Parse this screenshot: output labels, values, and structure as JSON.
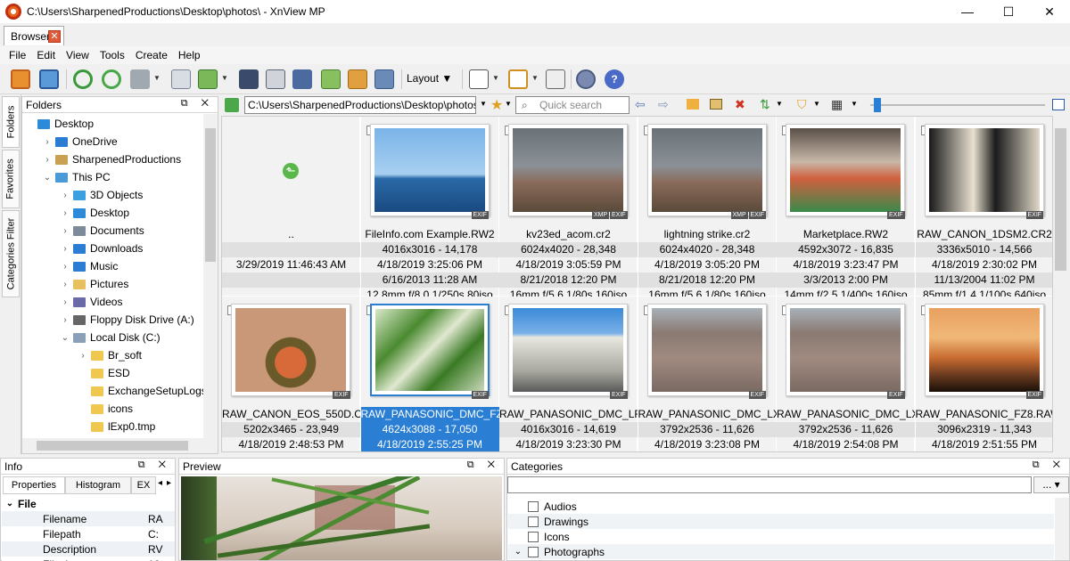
{
  "window": {
    "title": "C:\\Users\\SharpenedProductions\\Desktop\\photos\\ - XnView MP",
    "minimize": "—",
    "maximize": "☐",
    "close": "✕"
  },
  "tabs": [
    {
      "label": "Browser",
      "close": "✕"
    }
  ],
  "menu": [
    "File",
    "Edit",
    "View",
    "Tools",
    "Create",
    "Help"
  ],
  "toolbar": {
    "layout_label": "Layout"
  },
  "side_tabs": [
    "Folders",
    "Favorites",
    "Categories Filter"
  ],
  "folders": {
    "title": "Folders",
    "controls": "⧉ ✕",
    "items": [
      {
        "label": "Desktop",
        "level": 0,
        "expander": "",
        "icon": "desktop-icon",
        "color": "#2d8ad8"
      },
      {
        "label": "OneDrive",
        "level": 1,
        "expander": "›",
        "icon": "cloud-icon",
        "color": "#2b7cd3"
      },
      {
        "label": "SharpenedProductions",
        "level": 1,
        "expander": "›",
        "icon": "user-folder-icon",
        "color": "#caa052"
      },
      {
        "label": "This PC",
        "level": 1,
        "expander": "⌄",
        "icon": "computer-icon",
        "color": "#4a9ad8"
      },
      {
        "label": "3D Objects",
        "level": 2,
        "expander": "›",
        "icon": "3d-objects-icon",
        "color": "#3aa0e0"
      },
      {
        "label": "Desktop",
        "level": 2,
        "expander": "›",
        "icon": "desktop-icon",
        "color": "#2d8ad8"
      },
      {
        "label": "Documents",
        "level": 2,
        "expander": "›",
        "icon": "documents-icon",
        "color": "#7c8a9a"
      },
      {
        "label": "Downloads",
        "level": 2,
        "expander": "›",
        "icon": "downloads-icon",
        "color": "#2b7cd3"
      },
      {
        "label": "Music",
        "level": 2,
        "expander": "›",
        "icon": "music-icon",
        "color": "#2b7cd3"
      },
      {
        "label": "Pictures",
        "level": 2,
        "expander": "›",
        "icon": "pictures-icon",
        "color": "#e8c060"
      },
      {
        "label": "Videos",
        "level": 2,
        "expander": "›",
        "icon": "videos-icon",
        "color": "#6a6aa8"
      },
      {
        "label": "Floppy Disk Drive (A:)",
        "level": 2,
        "expander": "›",
        "icon": "floppy-icon",
        "color": "#666666"
      },
      {
        "label": "Local Disk (C:)",
        "level": 2,
        "expander": "⌄",
        "icon": "disk-icon",
        "color": "#8aa0b8"
      },
      {
        "label": "Br_soft",
        "level": 3,
        "expander": "›",
        "icon": "folder-icon",
        "color": "#f0c850"
      },
      {
        "label": "ESD",
        "level": 3,
        "expander": "",
        "icon": "folder-icon",
        "color": "#f0c850"
      },
      {
        "label": "ExchangeSetupLogs",
        "level": 3,
        "expander": "",
        "icon": "folder-icon",
        "color": "#f0c850"
      },
      {
        "label": "icons",
        "level": 3,
        "expander": "",
        "icon": "folder-icon",
        "color": "#f0c850"
      },
      {
        "label": "lExp0.tmp",
        "level": 3,
        "expander": "",
        "icon": "folder-icon",
        "color": "#f0c850"
      }
    ]
  },
  "address": {
    "path": "C:\\Users\\SharpenedProductions\\Desktop\\photos\\",
    "search_placeholder": "Quick search"
  },
  "grid": {
    "items": [
      {
        "name": "..",
        "lines": [
          "",
          "3/29/2019 11:46:43 AM",
          "",
          ""
        ],
        "thumb": "up-folder",
        "badges": [],
        "selected": false
      },
      {
        "name": "FileInfo.com Example.RW2",
        "lines": [
          "4016x3016 - 14,178",
          "4/18/2019 3:25:06 PM",
          "6/16/2013 11:28 AM",
          "12.8mm f/8.0 1/250s 80iso"
        ],
        "thumb": "lighthouse",
        "badges": [
          "EXIF"
        ],
        "selected": false
      },
      {
        "name": "kv23ed_acom.cr2",
        "lines": [
          "6024x4020 - 28,348",
          "4/18/2019 3:05:59 PM",
          "8/21/2018 12:20 PM",
          "16mm f/5.6 1/80s 160iso"
        ],
        "thumb": "storm",
        "badges": [
          "XMP",
          "EXIF"
        ],
        "selected": false
      },
      {
        "name": "lightning strike.cr2",
        "lines": [
          "6024x4020 - 28,348",
          "4/18/2019 3:05:20 PM",
          "8/21/2018 12:20 PM",
          "16mm f/5.6 1/80s 160iso"
        ],
        "thumb": "storm",
        "badges": [
          "XMP",
          "EXIF"
        ],
        "selected": false
      },
      {
        "name": "Marketplace.RW2",
        "lines": [
          "4592x3072 - 16,835",
          "4/18/2019 3:23:47 PM",
          "3/3/2013 2:00 PM",
          "14mm f/2.5 1/400s 160iso"
        ],
        "thumb": "market",
        "badges": [
          "EXIF"
        ],
        "selected": false
      },
      {
        "name": "RAW_CANON_1DSM2.CR2",
        "lines": [
          "3336x5010 - 14,566",
          "4/18/2019 2:30:02 PM",
          "11/13/2004 11:02 PM",
          "85mm f/1.4 1/100s 640iso"
        ],
        "thumb": "lenses",
        "badges": [
          "EXIF"
        ],
        "selected": false
      },
      {
        "name": "RAW_CANON_EOS_550D.CR2",
        "lines": [
          "5202x3465 - 23,949",
          "4/18/2019 2:48:53 PM"
        ],
        "thumb": "fruit",
        "badges": [
          "EXIF"
        ],
        "selected": false
      },
      {
        "name": "RAW_PANASONIC_DMC_FZ...",
        "lines": [
          "4624x3088 - 17,050",
          "4/18/2019 2:55:25 PM"
        ],
        "thumb": "palm",
        "badges": [
          "EXIF"
        ],
        "selected": true
      },
      {
        "name": "RAW_PANASONIC_DMC_LF1.",
        "lines": [
          "4016x3016 - 14,619",
          "4/18/2019 3:23:30 PM"
        ],
        "thumb": "building",
        "badges": [
          "EXIF"
        ],
        "selected": false
      },
      {
        "name": "RAW_PANASONIC_DMC_LX7.",
        "lines": [
          "3792x2536 - 11,626",
          "4/18/2019 3:23:08 PM"
        ],
        "thumb": "city",
        "badges": [
          "EXIF"
        ],
        "selected": false
      },
      {
        "name": "RAW_PANASONIC_DMC_LX7.",
        "lines": [
          "3792x2536 - 11,626",
          "4/18/2019 2:54:08 PM"
        ],
        "thumb": "city",
        "badges": [
          "EXIF"
        ],
        "selected": false
      },
      {
        "name": "RAW_PANASONIC_FZ8.RAW",
        "lines": [
          "3096x2319 - 11,343",
          "4/18/2019 2:51:55 PM"
        ],
        "thumb": "sunset",
        "badges": [
          "EXIF"
        ],
        "selected": false
      }
    ]
  },
  "info_panel": {
    "title": "Info",
    "controls": "⧉ ✕",
    "tabs": [
      "Properties",
      "Histogram",
      "EX"
    ],
    "section": "File",
    "rows": [
      {
        "label": "Filename",
        "value": "RA"
      },
      {
        "label": "Filepath",
        "value": "C:"
      },
      {
        "label": "Description",
        "value": "RV"
      },
      {
        "label": "Filesize",
        "value": "16"
      }
    ]
  },
  "preview_panel": {
    "title": "Preview",
    "controls": "⧉ ✕"
  },
  "categories_panel": {
    "title": "Categories",
    "controls": "⧉ ✕",
    "more_button": "...",
    "items": [
      {
        "label": "Audios",
        "expander": ""
      },
      {
        "label": "Drawings",
        "expander": ""
      },
      {
        "label": "Icons",
        "expander": ""
      },
      {
        "label": "Photographs",
        "expander": "⌄"
      }
    ]
  },
  "colors": {
    "selection": "#2a7fd4",
    "accent": "#3a7ad8"
  }
}
